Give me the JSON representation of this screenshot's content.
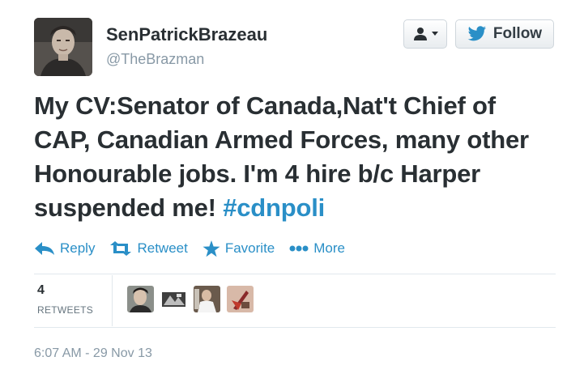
{
  "user": {
    "full_name": "SenPatrickBrazeau",
    "handle": "@TheBrazman"
  },
  "buttons": {
    "user_dropdown_icon": "person-icon",
    "follow_label": "Follow"
  },
  "tweet": {
    "text_main": "My CV:Senator of Canada,Nat't Chief of CAP, Canadian Armed Forces, many other Honourable jobs. I'm 4 hire b/c Harper suspended me! ",
    "hashtag": "#cdnpoli"
  },
  "actions": [
    {
      "label": "Reply",
      "icon": "reply-icon"
    },
    {
      "label": "Retweet",
      "icon": "retweet-icon"
    },
    {
      "label": "Favorite",
      "icon": "star-icon"
    },
    {
      "label": "More",
      "icon": "more-dots-icon"
    }
  ],
  "stats": {
    "retweet_count": "4",
    "retweet_label": "RETWEETS"
  },
  "timestamp": "6:07 AM - 29 Nov 13",
  "colors": {
    "link": "#2a8fc7",
    "muted": "#8899a6",
    "text": "#292f33"
  }
}
